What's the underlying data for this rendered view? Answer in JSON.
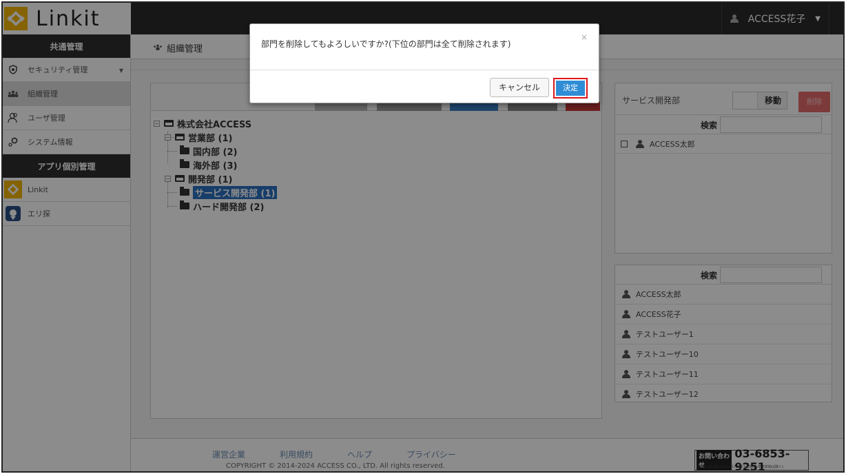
{
  "app": {
    "logo_text": "Linkit",
    "user_name": "ACCESS花子"
  },
  "sidebar": {
    "section_common": "共通管理",
    "items_common": [
      {
        "label": "セキュリティ管理",
        "icon": "shield-icon"
      },
      {
        "label": "組織管理",
        "icon": "organization-icon"
      },
      {
        "label": "ユーザ管理",
        "icon": "users-icon"
      },
      {
        "label": "システム情報",
        "icon": "system-info-icon"
      }
    ],
    "section_apps": "アプリ個別管理",
    "items_apps": [
      {
        "label": "Linkit",
        "icon": "linkit-app-icon"
      },
      {
        "label": "エリ探",
        "icon": "erisagashi-app-icon"
      }
    ]
  },
  "main": {
    "title": "組織管理"
  },
  "tree": {
    "root": "株式会社ACCESS",
    "nodes": [
      "営業部 (1)",
      "国内部 (2)",
      "海外部 (3)",
      "開発部 (1)",
      "サービス開発部 (1)",
      "ハード開発部 (2)"
    ]
  },
  "dept_panel": {
    "dept_name": "サービス開発部",
    "move_label": "移動",
    "delete_label": "削除",
    "search_label": "検索",
    "members": [
      "ACCESS太郎"
    ]
  },
  "user_panel": {
    "search_label": "検索",
    "users": [
      "ACCESS太郎",
      "ACCESS花子",
      "テストユーザー1",
      "テストユーザー10",
      "テストユーザー11",
      "テストユーザー12"
    ]
  },
  "footer": {
    "links": [
      "運営企業",
      "利用規約",
      "ヘルプ",
      "プライバシー"
    ],
    "copyright": "COPYRIGHT © 2014-2024 ACCESS CO., LTD. All rights reserved.",
    "contact_badge": "お問い合わせ",
    "phone": "03-6853-9251",
    "hours": "9:00~12:00·13:00~17:30(土日祝日·年末年始は除く)"
  },
  "modal": {
    "message": "部門を削除してもよろしいですか?(下位の部門は全て削除されます)",
    "close": "×",
    "cancel_label": "キャンセル",
    "ok_label": "決定"
  },
  "colors": {
    "primary": "#2f8dd6",
    "danger": "#e46a6a",
    "topbar": "#2b2b2b",
    "highlight": "#d9161b"
  }
}
